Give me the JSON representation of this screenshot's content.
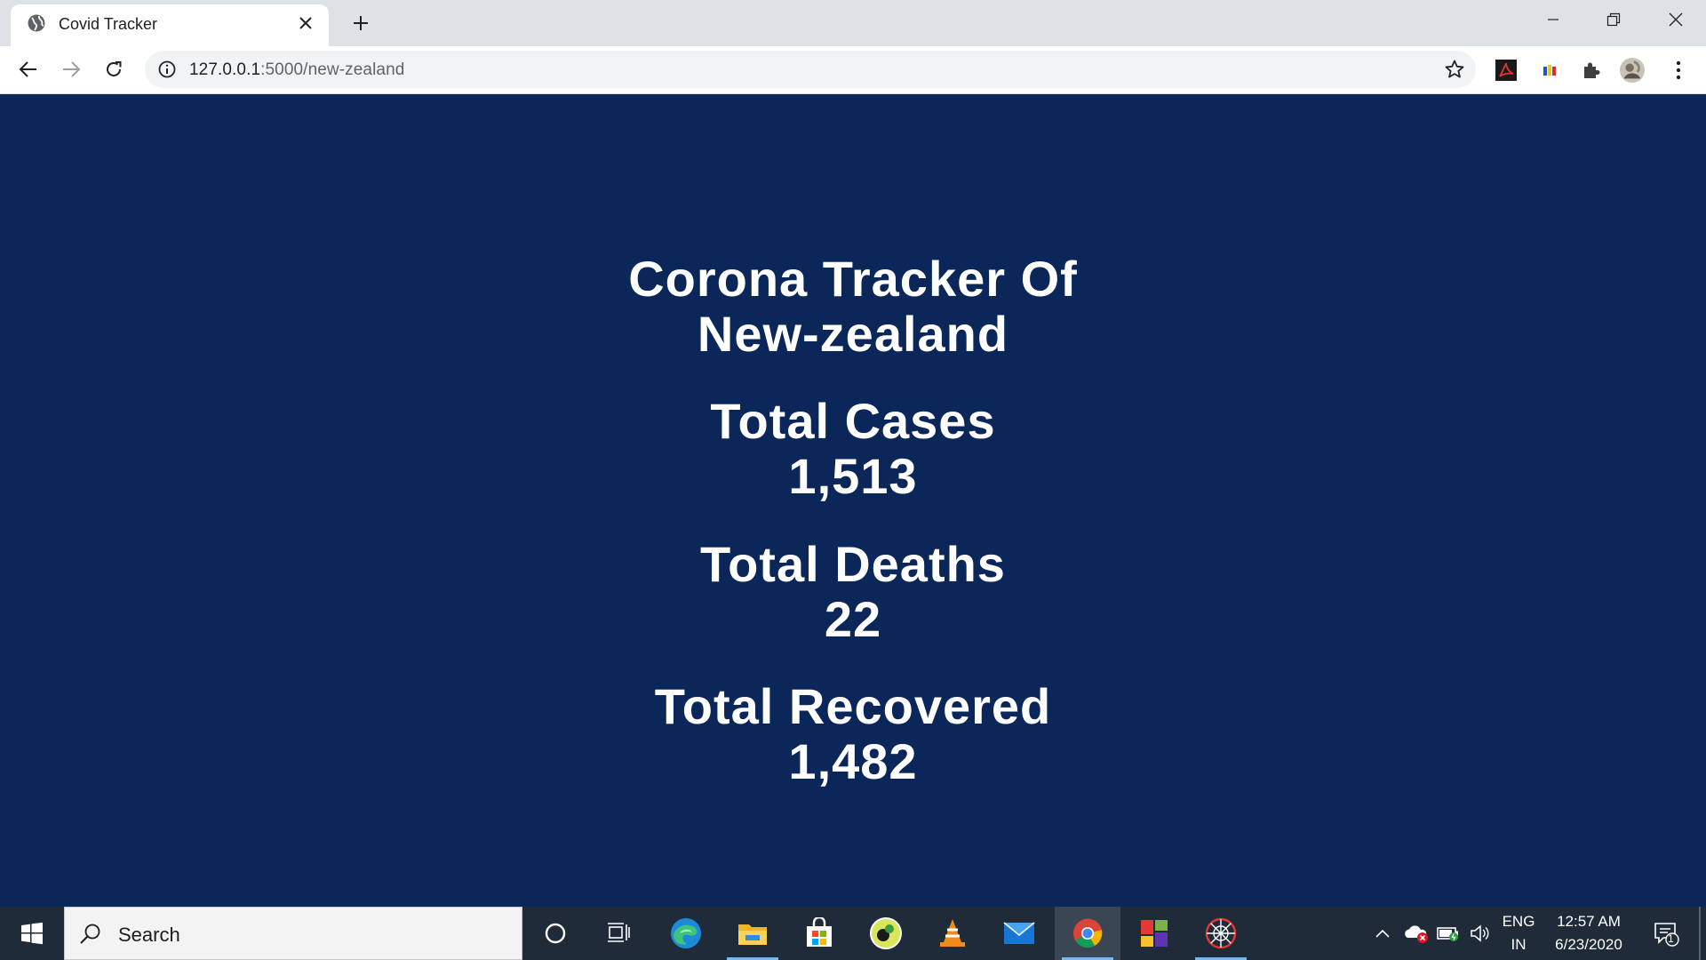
{
  "browser": {
    "tab_title": "Covid Tracker",
    "url_host": "127.0.0.1",
    "url_path": ":5000/new-zealand",
    "new_tab_icon": "plus-icon"
  },
  "page": {
    "title_line1": "Corona Tracker Of",
    "title_line2": "New-zealand",
    "stats": [
      {
        "label": "Total Cases",
        "value": "1,513"
      },
      {
        "label": "Total Deaths",
        "value": "22"
      },
      {
        "label": "Total Recovered",
        "value": "1,482"
      }
    ]
  },
  "taskbar": {
    "search_placeholder": "Search",
    "language_line1": "ENG",
    "language_line2": "IN",
    "time": "12:57 AM",
    "date": "6/23/2020",
    "notification_count": "1"
  },
  "colors": {
    "page_background": "#0b2658",
    "text": "#ffffff",
    "taskbar": "#1f2b38"
  }
}
